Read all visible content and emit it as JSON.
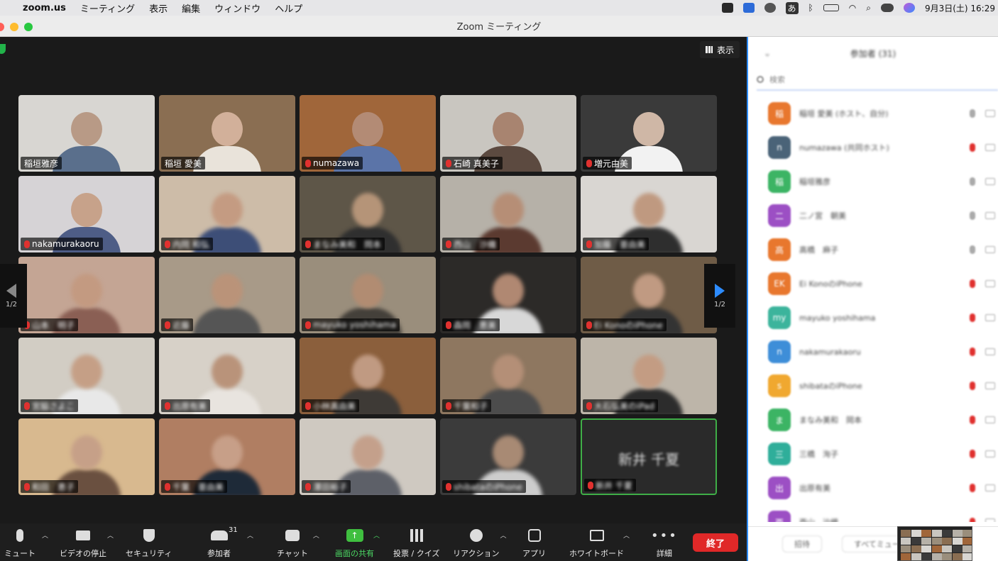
{
  "menubar": {
    "app": "zoom.us",
    "items": [
      "ミーティング",
      "表示",
      "編集",
      "ウィンドウ",
      "ヘルプ"
    ],
    "status_icons": [
      "video-status-icon",
      "dropbox-icon",
      "creative-cloud-icon",
      "input-method-icon",
      "bluetooth-icon",
      "battery-icon",
      "wifi-icon",
      "spotlight-icon",
      "control-center-icon",
      "siri-icon"
    ],
    "ime": "あ",
    "clock": "9月3日(土)  16:29"
  },
  "window": {
    "title": "Zoom ミーティング"
  },
  "view_button": {
    "label": "表示"
  },
  "pager": {
    "page": "1/2"
  },
  "tiles": [
    {
      "name": "稲垣雅彦",
      "muted": false,
      "bg": "#d8d6d2",
      "skin": "#b89a86",
      "shirt": "#5a6f8c",
      "blurred": false
    },
    {
      "name": "稲垣 愛美",
      "muted": false,
      "bg": "#8a6e52",
      "skin": "#d2b09a",
      "shirt": "#e9e3da",
      "blurred": false
    },
    {
      "name": "numazawa",
      "muted": true,
      "bg": "#a0663a",
      "skin": "#b38b75",
      "shirt": "#5b74a8",
      "blurred": false
    },
    {
      "name": "石崎 真美子",
      "muted": true,
      "bg": "#c9c6c0",
      "skin": "#a88470",
      "shirt": "#5c4a40",
      "blurred": false
    },
    {
      "name": "増元由美",
      "muted": true,
      "bg": "#3a3a3a",
      "skin": "#cfb7a6",
      "shirt": "#f2f2f2",
      "blurred": false
    },
    {
      "name": "nakamurakaoru",
      "muted": true,
      "bg": "#d6d3d6",
      "skin": "#c7a28a",
      "shirt": "#4e5d86",
      "blurred": false
    },
    {
      "name": "内岡 和弘",
      "muted": true,
      "bg": "#cdbca8",
      "skin": "#c49b82",
      "shirt": "#3d4e77",
      "blurred": true
    },
    {
      "name": "まなみ美和　岡本",
      "muted": true,
      "bg": "#5e5648",
      "skin": "#b59478",
      "shirt": "#2f2f2f",
      "blurred": true
    },
    {
      "name": "西山　沙織",
      "muted": true,
      "bg": "#b6b1a8",
      "skin": "#b68e76",
      "shirt": "#5b3a30",
      "blurred": true
    },
    {
      "name": "加藤　亜由美",
      "muted": true,
      "bg": "#d9d6d2",
      "skin": "#bf9980",
      "shirt": "#2e2e2e",
      "blurred": true
    },
    {
      "name": "山本　明子",
      "muted": true,
      "bg": "#c4a594",
      "skin": "#c39a81",
      "shirt": "#8a5f54",
      "blurred": true
    },
    {
      "name": "近藤",
      "muted": true,
      "bg": "#a89a88",
      "skin": "#ba9379",
      "shirt": "#555555",
      "blurred": true
    },
    {
      "name": "mayuko yoshihama",
      "muted": true,
      "bg": "#9a8e7c",
      "skin": "#b18c72",
      "shirt": "#44403a",
      "blurred": true
    },
    {
      "name": "森岡　恵美",
      "muted": true,
      "bg": "#2c2a28",
      "skin": "#b08872",
      "shirt": "#d8d8d8",
      "blurred": true
    },
    {
      "name": "Ei KonoのiPhone",
      "muted": true,
      "bg": "#6f5c47",
      "skin": "#c09a82",
      "shirt": "#333333",
      "blurred": true
    },
    {
      "name": "宮脇さよこ",
      "muted": true,
      "bg": "#d2cdc4",
      "skin": "#c59f86",
      "shirt": "#e8e8e8",
      "blurred": true
    },
    {
      "name": "出原有美",
      "muted": true,
      "bg": "#d7d1c8",
      "skin": "#b9937a",
      "shirt": "#e8e4df",
      "blurred": true
    },
    {
      "name": "小林真由美",
      "muted": true,
      "bg": "#8b5f3c",
      "skin": "#c09a82",
      "shirt": "#3e3a36",
      "blurred": true
    },
    {
      "name": "千葉和子",
      "muted": true,
      "bg": "#8e7760",
      "skin": "#b48f77",
      "shirt": "#4c4c4c",
      "blurred": true
    },
    {
      "name": "大石弘美のiPad",
      "muted": true,
      "bg": "#bdb5a9",
      "skin": "#c39c83",
      "shirt": "#2c2c2c",
      "blurred": true
    },
    {
      "name": "和田　恵子",
      "muted": true,
      "bg": "#d8b98f",
      "skin": "#c6a088",
      "shirt": "#6a5040",
      "blurred": true
    },
    {
      "name": "千葉　亜由美",
      "muted": true,
      "bg": "#b07e62",
      "skin": "#c79f88",
      "shirt": "#1e2a38",
      "blurred": true
    },
    {
      "name": "澤田裕子",
      "muted": true,
      "bg": "#cfc9c1",
      "skin": "#c4a08b",
      "shirt": "#5d6068",
      "blurred": true
    },
    {
      "name": "shibataのiPhone",
      "muted": true,
      "bg": "#3b3b3b",
      "skin": "#a88a74",
      "shirt": "#cdcdcd",
      "blurred": true
    },
    {
      "name": "新井 千夏",
      "muted": true,
      "text_only": true,
      "big_label": "新井 千夏",
      "blurred": true
    }
  ],
  "toolbar": {
    "mute": "ミュート",
    "video": "ビデオの停止",
    "security": "セキュリティ",
    "participants": "参加者",
    "participants_count": "31",
    "chat": "チャット",
    "share": "画面の共有",
    "poll": "投票 / クイズ",
    "reaction": "リアクション",
    "apps": "アプリ",
    "whiteboard": "ホワイトボード",
    "more": "詳細",
    "end": "終了"
  },
  "panel": {
    "title": "参加者 (31)",
    "search_placeholder": "検索",
    "participants": [
      {
        "initial": "稲",
        "color": "#e8772e",
        "name": "稲垣 愛美 (ホスト、自分)",
        "mic": "#aaaaaa"
      },
      {
        "initial": "n",
        "color": "#4a6378",
        "name": "numazawa (共同ホスト)",
        "mic": "#e0312f"
      },
      {
        "initial": "稲",
        "color": "#3cb464",
        "name": "稲垣雅彦",
        "mic": "#aaaaaa"
      },
      {
        "initial": "二",
        "color": "#9c4fc4",
        "name": "二ノ宮　朝美",
        "mic": "#aaaaaa"
      },
      {
        "initial": "高",
        "color": "#e8772e",
        "name": "高橋　麻子",
        "mic": "#aaaaaa"
      },
      {
        "initial": "EK",
        "color": "#e8772e",
        "name": "Ei KonoのiPhone",
        "mic": "#e0312f"
      },
      {
        "initial": "my",
        "color": "#3cb49c",
        "name": "mayuko yoshihama",
        "mic": "#e0312f"
      },
      {
        "initial": "n",
        "color": "#3e8ed8",
        "name": "nakamurakaoru",
        "mic": "#e0312f"
      },
      {
        "initial": "s",
        "color": "#f0a830",
        "name": "shibataのiPhone",
        "mic": "#e0312f"
      },
      {
        "initial": "ま",
        "color": "#3cb464",
        "name": "まなみ美和　岡本",
        "mic": "#e0312f"
      },
      {
        "initial": "三",
        "color": "#2fae9a",
        "name": "三橋　洵子",
        "mic": "#e0312f"
      },
      {
        "initial": "出",
        "color": "#9c4fc4",
        "name": "出原有美",
        "mic": "#e0312f"
      },
      {
        "initial": "西",
        "color": "#9c4fc4",
        "name": "西山　沙織",
        "mic": "#e0312f"
      }
    ],
    "footer": {
      "invite": "招待",
      "mute_all": "すべてミュート"
    }
  }
}
